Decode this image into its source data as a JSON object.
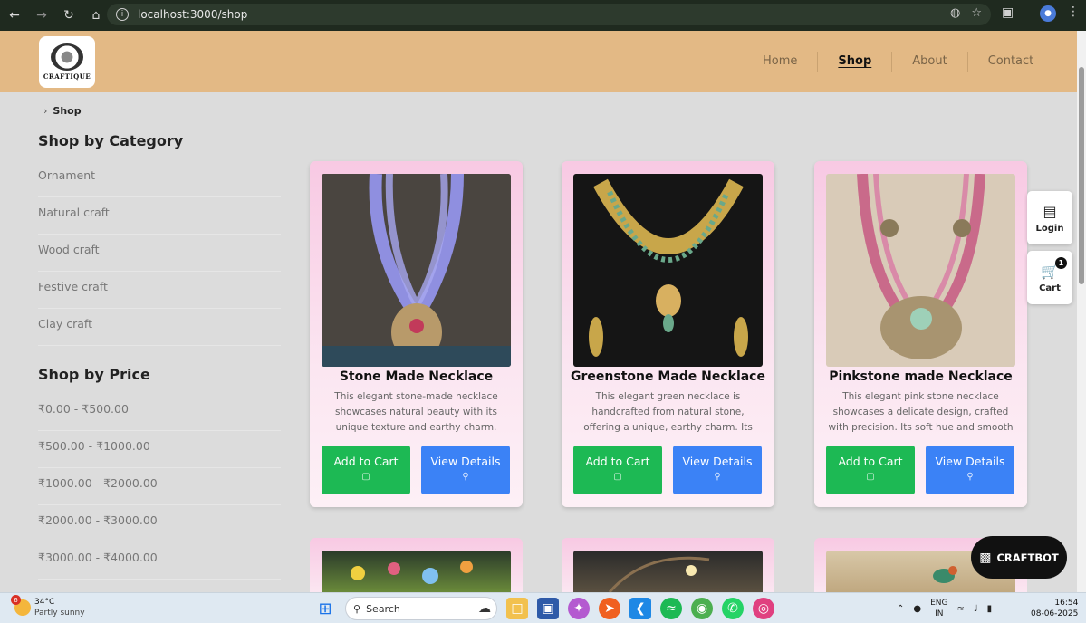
{
  "browser": {
    "url": "localhost:3000/shop"
  },
  "header": {
    "logo_text": "CRAFTIQUE",
    "nav": [
      {
        "label": "Home",
        "active": false
      },
      {
        "label": "Shop",
        "active": true
      },
      {
        "label": "About",
        "active": false
      },
      {
        "label": "Contact",
        "active": false
      }
    ]
  },
  "breadcrumb": {
    "current": "Shop"
  },
  "sidebar": {
    "category_title": "Shop by Category",
    "categories": [
      "Ornament",
      "Natural craft",
      "Wood craft",
      "Festive craft",
      "Clay craft"
    ],
    "price_title": "Shop by Price",
    "prices": [
      "₹0.00 - ₹500.00",
      "₹500.00 - ₹1000.00",
      "₹1000.00 - ₹2000.00",
      "₹2000.00 - ₹3000.00",
      "₹3000.00 - ₹4000.00"
    ]
  },
  "products": [
    {
      "title": "Stone Made Necklace",
      "description": "This elegant stone-made necklace showcases natural beauty with its unique texture and earthy charm. Perfect",
      "cart_label": "Add to Cart",
      "view_label": "View Details"
    },
    {
      "title": "Greenstone Made Necklace",
      "description": "This elegant green necklace is handcrafted from natural stone, offering a unique, earthy charm. Its smooth finish",
      "cart_label": "Add to Cart",
      "view_label": "View Details"
    },
    {
      "title": "Pinkstone made Necklace",
      "description": "This elegant pink stone necklace showcases a delicate design, crafted with precision. Its soft hue and smooth",
      "cart_label": "Add to Cart",
      "view_label": "View Details"
    }
  ],
  "floating": {
    "login_label": "Login",
    "cart_label": "Cart",
    "cart_count": "1",
    "chatbot_label": "CRAFTBOT"
  },
  "taskbar": {
    "weather_badge": "6",
    "temperature": "34°C",
    "condition": "Partly sunny",
    "search_placeholder": "Search",
    "lang_top": "ENG",
    "lang_bottom": "IN",
    "time": "16:54",
    "date": "08-06-2025"
  },
  "colors": {
    "header_bg": "#e3b985",
    "add_to_cart": "#1db954",
    "view_details": "#3b82f6",
    "card_pink": "#f8c9e3"
  }
}
